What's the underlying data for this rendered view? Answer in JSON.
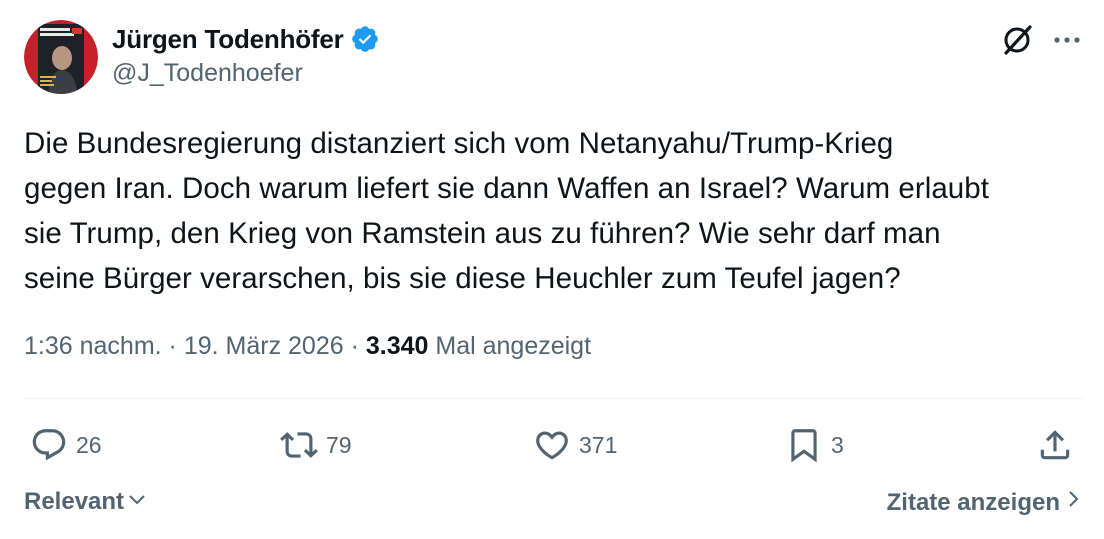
{
  "author": {
    "name": "Jürgen Todenhöfer",
    "handle": "@J_Todenhoefer",
    "verified": true,
    "avatar_icon": "book-cover-avatar"
  },
  "tweet": {
    "lines": [
      "Die Bundesregierung distanziert sich vom Netanyahu/Trump-Krieg",
      "gegen Iran. Doch warum liefert sie dann Waffen an Israel? Warum erlaubt",
      "sie Trump, den Krieg von Ramstein aus zu führen? Wie sehr darf man",
      "seine Bürger verarschen, bis sie diese Heuchler zum Teufel jagen?"
    ]
  },
  "meta": {
    "time": "1:36 nachm.",
    "separator": " · ",
    "date": "19. März 2026",
    "views_count": "3.340",
    "views_label": "Mal angezeigt"
  },
  "actions": {
    "reply_count": "26",
    "retweet_count": "79",
    "like_count": "371",
    "bookmark_count": "3"
  },
  "footer": {
    "sort_label": "Relevant",
    "quotes_label": "Zitate anzeigen"
  },
  "colors": {
    "text": "#0f1419",
    "secondary": "#536471",
    "verified_blue": "#1d9bf0",
    "divider": "#eff3f4"
  },
  "icons": {
    "verified": "verified-badge-icon",
    "grok": "grok-icon",
    "more": "more-icon",
    "reply": "reply-icon",
    "retweet": "retweet-icon",
    "like": "heart-icon",
    "bookmark": "bookmark-icon",
    "share": "share-icon",
    "chevron_down": "chevron-down-icon",
    "chevron_right": "chevron-right-icon"
  }
}
